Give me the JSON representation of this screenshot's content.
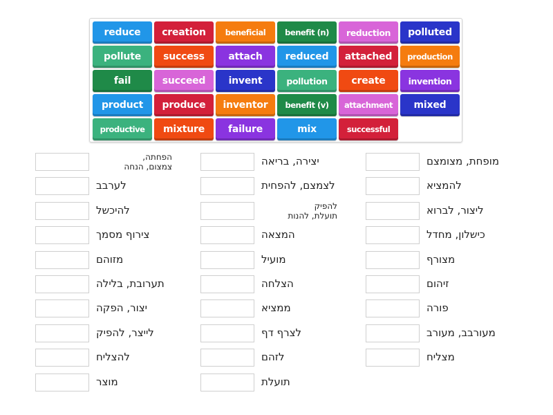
{
  "tile_colors": {
    "blue": "#2196e8",
    "red": "#d3203a",
    "orange": "#f57c0f",
    "teal": "#3bb27e",
    "orangered": "#f04a12",
    "purple": "#8a34e0",
    "darkgreen": "#1f8a48",
    "pink": "#d865d8",
    "navy": "#2a35c9"
  },
  "tiles": [
    {
      "text": "reduce",
      "color": "blue"
    },
    {
      "text": "creation",
      "color": "red"
    },
    {
      "text": "beneficial",
      "color": "orange"
    },
    {
      "text": "benefit (n)",
      "color": "darkgreen"
    },
    {
      "text": "reduction",
      "color": "pink"
    },
    {
      "text": "polluted",
      "color": "navy"
    },
    {
      "text": "pollute",
      "color": "teal"
    },
    {
      "text": "success",
      "color": "orangered"
    },
    {
      "text": "attach",
      "color": "purple"
    },
    {
      "text": "reduced",
      "color": "blue"
    },
    {
      "text": "attached",
      "color": "red"
    },
    {
      "text": "production",
      "color": "orange"
    },
    {
      "text": "fail",
      "color": "darkgreen"
    },
    {
      "text": "succeed",
      "color": "pink"
    },
    {
      "text": "invent",
      "color": "navy"
    },
    {
      "text": "pollution",
      "color": "teal"
    },
    {
      "text": "create",
      "color": "orangered"
    },
    {
      "text": "invention",
      "color": "purple"
    },
    {
      "text": "product",
      "color": "blue"
    },
    {
      "text": "produce",
      "color": "red"
    },
    {
      "text": "inventor",
      "color": "orange"
    },
    {
      "text": "benefit (v)",
      "color": "darkgreen"
    },
    {
      "text": "attachment",
      "color": "pink"
    },
    {
      "text": "mixed",
      "color": "navy"
    },
    {
      "text": "productive",
      "color": "teal"
    },
    {
      "text": "mixture",
      "color": "orangered"
    },
    {
      "text": "failure",
      "color": "purple"
    },
    {
      "text": "mix",
      "color": "blue"
    },
    {
      "text": "successful",
      "color": "red"
    }
  ],
  "columns": [
    {
      "items": [
        {
          "label": "הפחתה, צמצום, הנחה",
          "line1": "הפחתה,",
          "line2": "צמצום, הנחה",
          "answer": ""
        },
        {
          "label": "לערבב",
          "answer": ""
        },
        {
          "label": "להיכשל",
          "answer": ""
        },
        {
          "label": "צירוף מסמך",
          "answer": ""
        },
        {
          "label": "מזוהם",
          "answer": ""
        },
        {
          "label": "תערובת, בלילה",
          "answer": ""
        },
        {
          "label": "יצור, הפקה",
          "answer": ""
        },
        {
          "label": "לייצר, להפיק",
          "answer": ""
        },
        {
          "label": "להצליח",
          "answer": ""
        },
        {
          "label": "מוצר",
          "answer": ""
        }
      ]
    },
    {
      "items": [
        {
          "label": "יצירה, בריאה",
          "answer": ""
        },
        {
          "label": "לצמצם, להפחית",
          "answer": ""
        },
        {
          "label": "להפיק תועלת, להנות",
          "line1": "להפיק",
          "line2": "תועלת, להנות",
          "answer": ""
        },
        {
          "label": "המצאה",
          "answer": ""
        },
        {
          "label": "מועיל",
          "answer": ""
        },
        {
          "label": "הצלחה",
          "answer": ""
        },
        {
          "label": "ממציא",
          "answer": ""
        },
        {
          "label": "לצרף דף",
          "answer": ""
        },
        {
          "label": "לזהם",
          "answer": ""
        },
        {
          "label": "תועלת",
          "answer": ""
        }
      ]
    },
    {
      "items": [
        {
          "label": "מופחת, מצומצם",
          "answer": ""
        },
        {
          "label": "להמציא",
          "answer": ""
        },
        {
          "label": "ליצור, לברוא",
          "answer": ""
        },
        {
          "label": "כישלון, מחדל",
          "answer": ""
        },
        {
          "label": "מצורף",
          "answer": ""
        },
        {
          "label": "זיהום",
          "answer": ""
        },
        {
          "label": "פורה",
          "answer": ""
        },
        {
          "label": "מעורבב, מעורב",
          "answer": ""
        },
        {
          "label": "מצליח",
          "answer": ""
        }
      ]
    }
  ]
}
